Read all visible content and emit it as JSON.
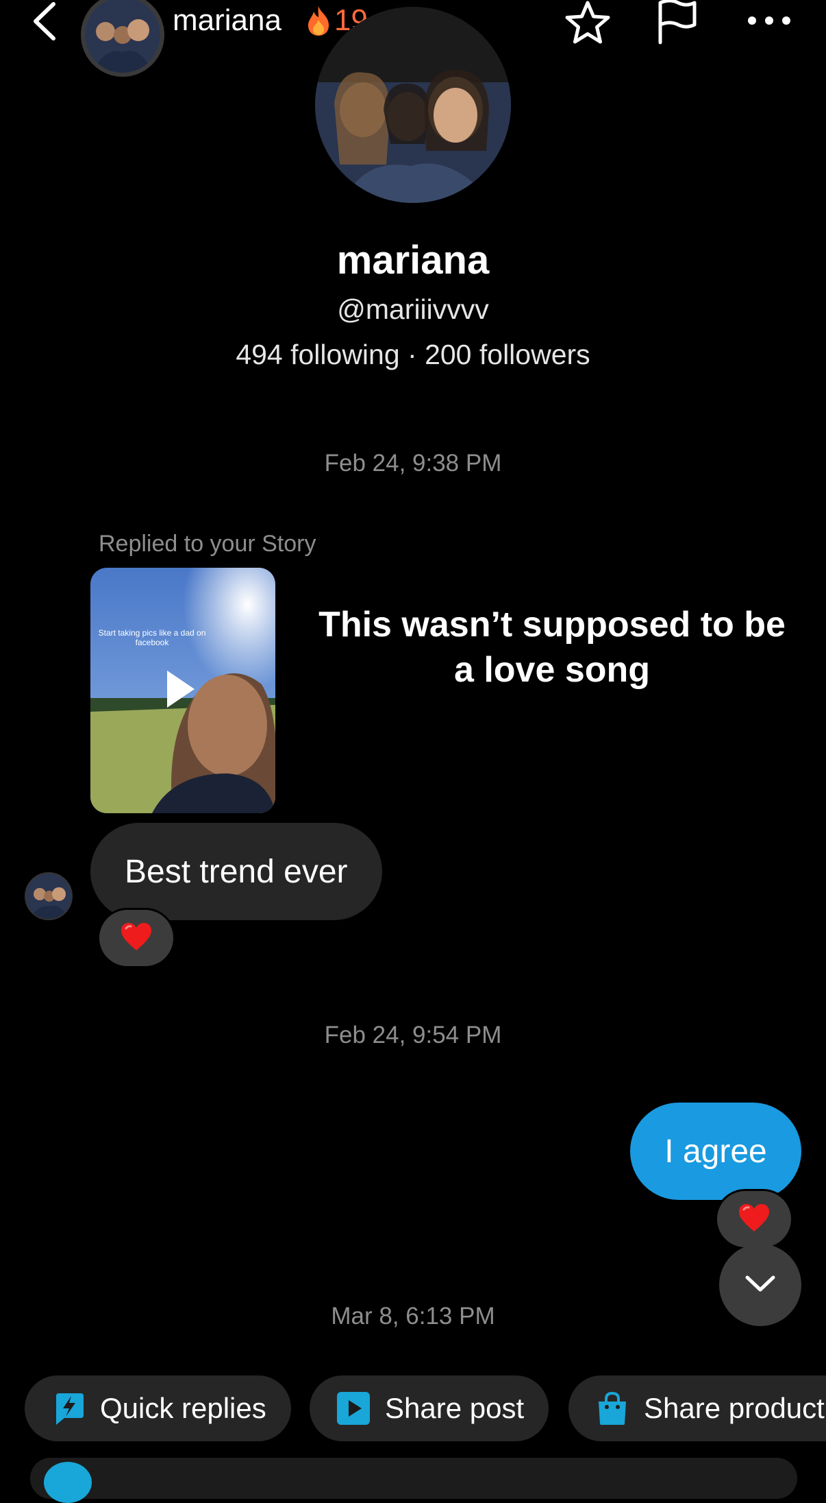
{
  "header": {
    "name": "mariana",
    "streak_count": "19",
    "icons": [
      "back-icon",
      "star-icon",
      "flag-icon",
      "more-icon"
    ]
  },
  "profile": {
    "name": "mariana",
    "handle": "@mariiivvvv",
    "stats": "494 following · 200 followers"
  },
  "messages": {
    "timestamp_1": "Feb 24, 9:38 PM",
    "story_label": "Replied to your Story",
    "story_thumb_text": "Start taking pics like a dad on facebook",
    "story_caption": "This wasn’t supposed to be a love song",
    "incoming_text": "Best trend ever",
    "timestamp_2": "Feb 24, 9:54 PM",
    "outgoing_text": "I agree",
    "timestamp_3": "Mar 8, 6:13 PM"
  },
  "quick_actions": {
    "quick_replies": "Quick replies",
    "share_post": "Share post",
    "share_product": "Share product"
  },
  "colors": {
    "background": "#000000",
    "incoming_bubble": "#262626",
    "outgoing_bubble": "#1a9ae0",
    "streak": "#ff6a3d",
    "accent": "#19a6d8"
  }
}
